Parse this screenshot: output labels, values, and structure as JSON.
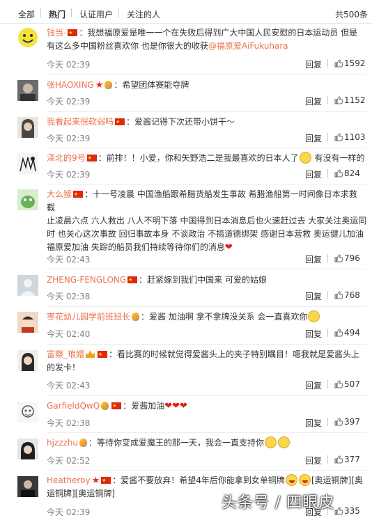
{
  "tabs": {
    "all": "全部",
    "hot": "热门",
    "verified": "认证用户",
    "following": "关注的人",
    "total": "共500条"
  },
  "reply_label": "回复",
  "watermark": "头条号 / 四眼皮",
  "comments": [
    {
      "user": "钱当-",
      "line1": "：我想福原爱是唯一一个在失败后得到广大中国人民安慰的日本运动员 但是",
      "line2": "有这么多中国粉丝喜欢你 也是你很大的收获",
      "mention": "@福原爱AiFukuhara",
      "time": "今天 02:39",
      "likes": "1592"
    },
    {
      "user": "张HAOXING",
      "line1": "：希望团体赛能夺牌",
      "time": "今天 02:39",
      "likes": "1152"
    },
    {
      "user": "我看起来很软弱吗",
      "line1": "：爱酱记得下次还带小饼干～",
      "time": "今天 02:39",
      "likes": "1103"
    },
    {
      "user": "泽北的9号",
      "line1": "：前排！！小爱，你和矢野浩二是我最喜欢的日本人了",
      "line1b": "有没有一样的",
      "time": "今天 02:39",
      "likes": "824"
    },
    {
      "user": "大么猴",
      "line1": "：十一号凌晨 中国渔船跟希腊货船发生事故 希腊渔船第一时间像日本求救 截",
      "line2": "止凌晨六点 六人救出 八人不明下落 中国得到日本消息后也火速赶过去 大家关注奥运同",
      "line3": "时 也关心这次事故 回归事故本身 不谈政治 不搞道德绑架 感谢日本营救 奥运健儿加油",
      "line4": "福原爱加油 失踪的船员我们持续等待你们的消息",
      "time": "今天 02:43",
      "likes": "796"
    },
    {
      "user": "ZHENG-FENGLONG",
      "line1": "：赶紧嫁到我们中国来 可爱的姑娘",
      "time": "今天 02:38",
      "likes": "768"
    },
    {
      "user": "枣花幼儿园学前班班长",
      "line1": "：爱酱 加油啊 拿不拿牌没关系 会一直喜欢你",
      "time": "今天 02:40",
      "likes": "494"
    },
    {
      "user": "富察_琅嬛",
      "line1": "：看比赛的时候就觉得爱酱头上的夹子特别瞩目！嗯我就是爱酱头上",
      "line2": "的发卡！",
      "time": "今天 02:43",
      "likes": "507"
    },
    {
      "user": "GarfieldQwQ",
      "line1": "：爱酱加油",
      "time": "今天 02:38",
      "likes": "397"
    },
    {
      "user": "hjzzzhu",
      "line1": "：等待你变成爱魔王的那一天，我会一直支持你",
      "time": "今天 02:52",
      "likes": "377"
    },
    {
      "user": "Heatheroy",
      "line1": "：爱酱不要放弃！希望4年后你能拿到女单铜牌",
      "line1b": "[奥运铜牌][奥",
      "line2": "运铜牌][奥运铜牌]",
      "time": "今天 02:39",
      "likes": "335"
    }
  ]
}
